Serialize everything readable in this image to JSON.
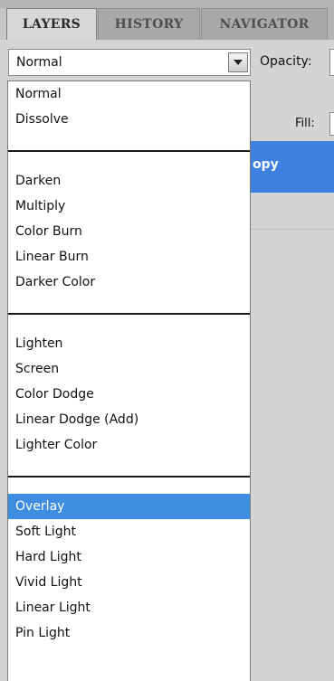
{
  "tabs": [
    {
      "label": "LAYERS",
      "active": true
    },
    {
      "label": "HISTORY",
      "active": false
    },
    {
      "label": "NAVIGATOR",
      "active": false
    }
  ],
  "blend_mode": {
    "selected": "Normal",
    "dropdown_icon": "chevron-down-icon"
  },
  "opacity": {
    "label": "Opacity:"
  },
  "fill": {
    "label": "Fill:"
  },
  "layer": {
    "name_visible": "opy"
  },
  "menu": {
    "groups": [
      [
        "Normal",
        "Dissolve"
      ],
      [
        "Darken",
        "Multiply",
        "Color Burn",
        "Linear Burn",
        "Darker Color"
      ],
      [
        "Lighten",
        "Screen",
        "Color Dodge",
        "Linear Dodge (Add)",
        "Lighter Color"
      ],
      [
        "Overlay",
        "Soft Light",
        "Hard Light",
        "Vivid Light",
        "Linear Light",
        "Pin Light"
      ]
    ],
    "highlighted": "Overlay"
  },
  "colors": {
    "selection": "#3d8ee0",
    "layer_selection": "#3d80df",
    "tab_bar": "#b3b3b3"
  }
}
